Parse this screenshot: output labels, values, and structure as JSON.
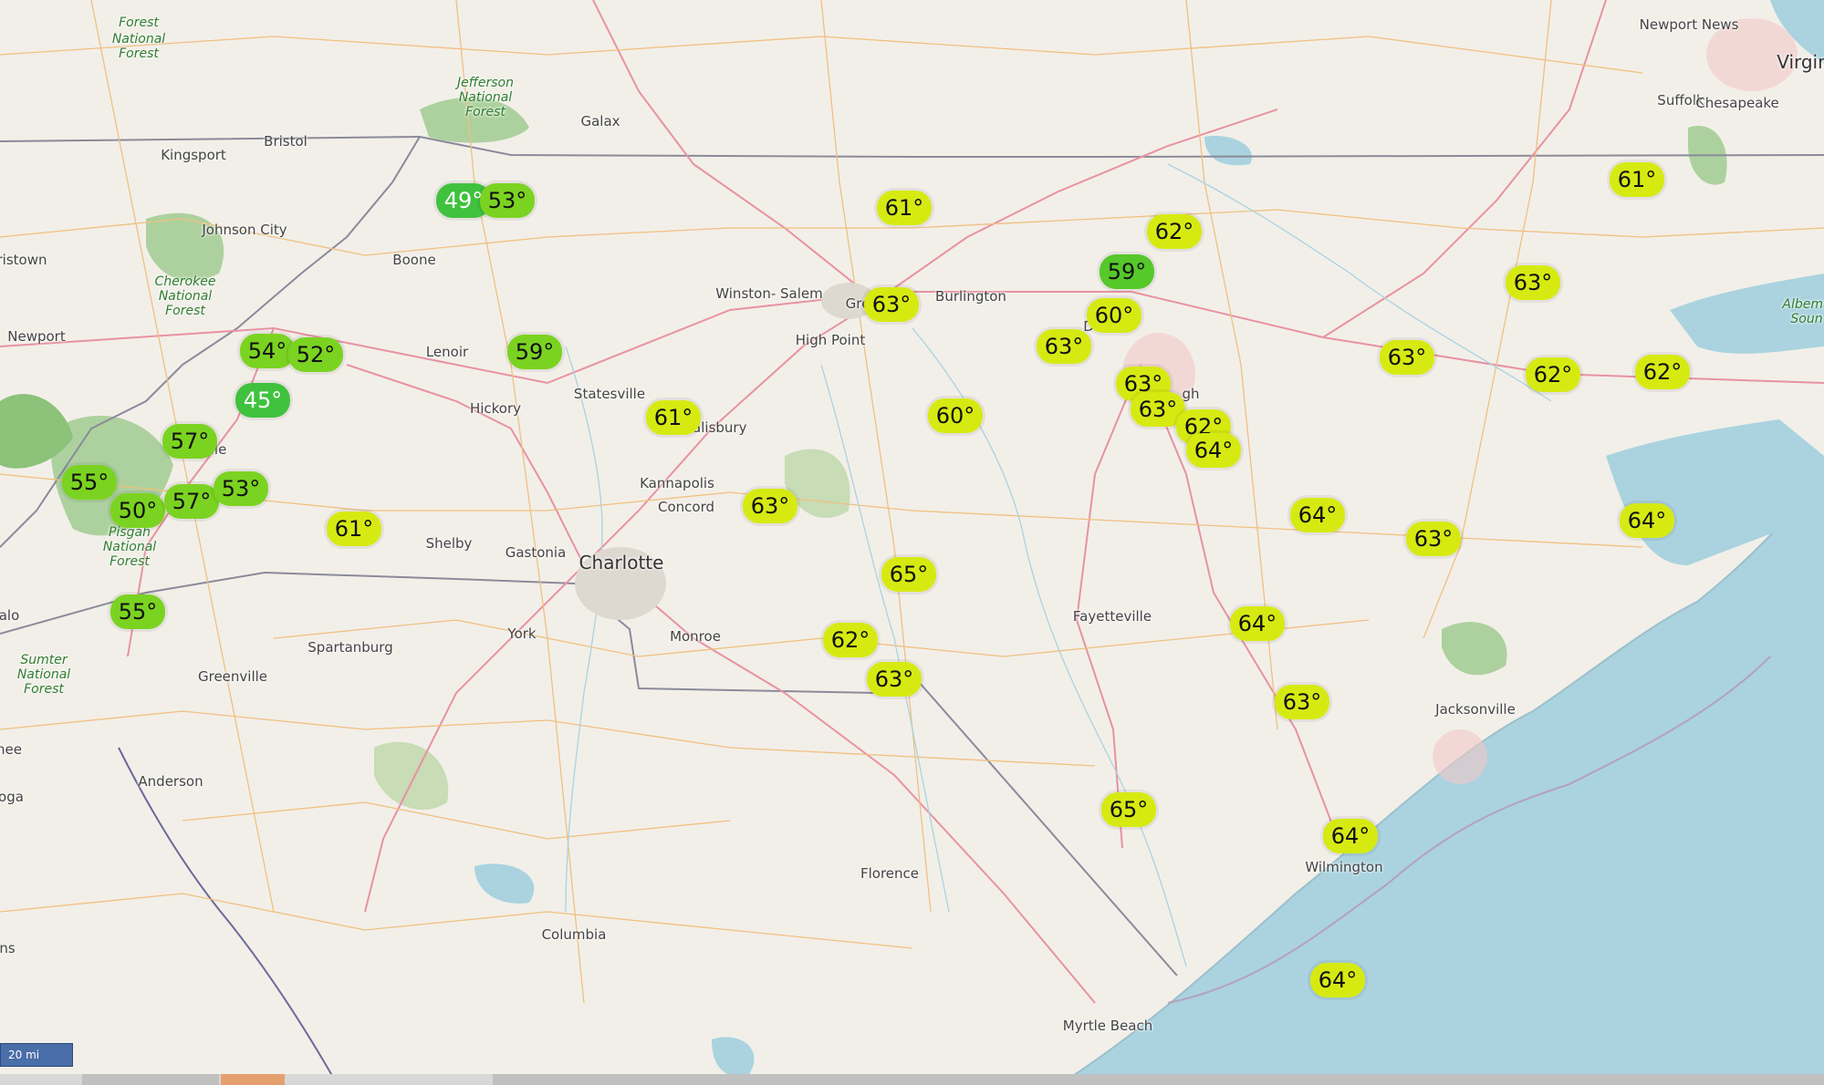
{
  "map": {
    "scale_label": "20 mi",
    "colors": {
      "land": "#f2efe9",
      "water": "#aad3df",
      "forest": "#add19e",
      "highway": "#e892a2",
      "road": "#f0c080",
      "border": "#8a8a9a",
      "warm_marker": "#d6ea12",
      "cool_marker": "#7bd321"
    },
    "places": [
      {
        "name": "Kingsport",
        "cls": "",
        "icon": "city-label"
      },
      {
        "name": "Bristol",
        "cls": ""
      },
      {
        "name": "Galax",
        "cls": ""
      },
      {
        "name": "Johnson\nCity",
        "cls": ""
      },
      {
        "name": "ristown",
        "cls": ""
      },
      {
        "name": "Boone",
        "cls": ""
      },
      {
        "name": "Newport",
        "cls": ""
      },
      {
        "name": "Lenoir",
        "cls": ""
      },
      {
        "name": "Hickory",
        "cls": ""
      },
      {
        "name": "Statesville",
        "cls": ""
      },
      {
        "name": "Winston-\nSalem",
        "cls": ""
      },
      {
        "name": "Gre",
        "cls": ""
      },
      {
        "name": "Burlington",
        "cls": ""
      },
      {
        "name": "High Point",
        "cls": ""
      },
      {
        "name": "Salisbury",
        "cls": ""
      },
      {
        "name": "Kannapolis",
        "cls": ""
      },
      {
        "name": "Concord",
        "cls": ""
      },
      {
        "name": "Shelby",
        "cls": ""
      },
      {
        "name": "Gastonia",
        "cls": ""
      },
      {
        "name": "Charlotte",
        "cls": "big"
      },
      {
        "name": "Monroe",
        "cls": ""
      },
      {
        "name": "York",
        "cls": ""
      },
      {
        "name": "Spartanburg",
        "cls": ""
      },
      {
        "name": "Greenville",
        "cls": ""
      },
      {
        "name": "Anderson",
        "cls": ""
      },
      {
        "name": "Columbia",
        "cls": ""
      },
      {
        "name": "Florence",
        "cls": ""
      },
      {
        "name": "Fayetteville",
        "cls": ""
      },
      {
        "name": "Myrtle Beach",
        "cls": ""
      },
      {
        "name": "Wilmington",
        "cls": ""
      },
      {
        "name": "Jacksonville",
        "cls": ""
      },
      {
        "name": "Suffolk",
        "cls": ""
      },
      {
        "name": "Chesapeake",
        "cls": ""
      },
      {
        "name": "Newport\nNews",
        "cls": ""
      },
      {
        "name": "Virgin",
        "cls": "big"
      },
      {
        "name": "gh",
        "cls": ""
      },
      {
        "name": "D",
        "cls": ""
      },
      {
        "name": "ville",
        "cls": ""
      },
      {
        "name": "ns",
        "cls": ""
      },
      {
        "name": "alo",
        "cls": ""
      },
      {
        "name": "hee",
        "cls": ""
      },
      {
        "name": "oga",
        "cls": ""
      },
      {
        "name": "Albema\nSoun",
        "cls": "forest"
      },
      {
        "name": "Jefferson\nNational\nForest",
        "cls": "forest"
      },
      {
        "name": "Cherokee\nNational\nForest",
        "cls": "forest"
      },
      {
        "name": "Pisgah\nNational\nForest",
        "cls": "forest"
      },
      {
        "name": "Sumter\nNational\nForest",
        "cls": "forest"
      },
      {
        "name": "Forest",
        "cls": "forest"
      },
      {
        "name": "National\nForest",
        "cls": "forest"
      }
    ],
    "temperatures": [
      {
        "label": "49°",
        "tone": "cold2"
      },
      {
        "label": "53°",
        "tone": "cool"
      },
      {
        "label": "61°",
        "tone": "warm"
      },
      {
        "label": "62°",
        "tone": "warm"
      },
      {
        "label": "59°",
        "tone": "cold"
      },
      {
        "label": "63°",
        "tone": "warm"
      },
      {
        "label": "60°",
        "tone": "warm"
      },
      {
        "label": "63°",
        "tone": "warm"
      },
      {
        "label": "61°",
        "tone": "warm"
      },
      {
        "label": "63°",
        "tone": "warm"
      },
      {
        "label": "54°",
        "tone": "cool"
      },
      {
        "label": "52°",
        "tone": "cool"
      },
      {
        "label": "59°",
        "tone": "cool"
      },
      {
        "label": "45°",
        "tone": "cold2"
      },
      {
        "label": "57°",
        "tone": "cool"
      },
      {
        "label": "55°",
        "tone": "cool"
      },
      {
        "label": "50°",
        "tone": "cool"
      },
      {
        "label": "57°",
        "tone": "cool"
      },
      {
        "label": "53°",
        "tone": "cool"
      },
      {
        "label": "61°",
        "tone": "warm"
      },
      {
        "label": "61°",
        "tone": "warm"
      },
      {
        "label": "60°",
        "tone": "warm"
      },
      {
        "label": "63°",
        "tone": "warm"
      },
      {
        "label": "63°",
        "tone": "warm"
      },
      {
        "label": "62°",
        "tone": "warm"
      },
      {
        "label": "64°",
        "tone": "warm"
      },
      {
        "label": "63°",
        "tone": "warm"
      },
      {
        "label": "62°",
        "tone": "warm"
      },
      {
        "label": "62°",
        "tone": "warm"
      },
      {
        "label": "63°",
        "tone": "warm"
      },
      {
        "label": "65°",
        "tone": "warm"
      },
      {
        "label": "64°",
        "tone": "warm"
      },
      {
        "label": "63°",
        "tone": "warm"
      },
      {
        "label": "64°",
        "tone": "warm"
      },
      {
        "label": "55°",
        "tone": "cool"
      },
      {
        "label": "62°",
        "tone": "warm"
      },
      {
        "label": "63°",
        "tone": "warm"
      },
      {
        "label": "64°",
        "tone": "warm"
      },
      {
        "label": "63°",
        "tone": "warm"
      },
      {
        "label": "65°",
        "tone": "warm"
      },
      {
        "label": "64°",
        "tone": "warm"
      },
      {
        "label": "64°",
        "tone": "warm"
      }
    ]
  }
}
